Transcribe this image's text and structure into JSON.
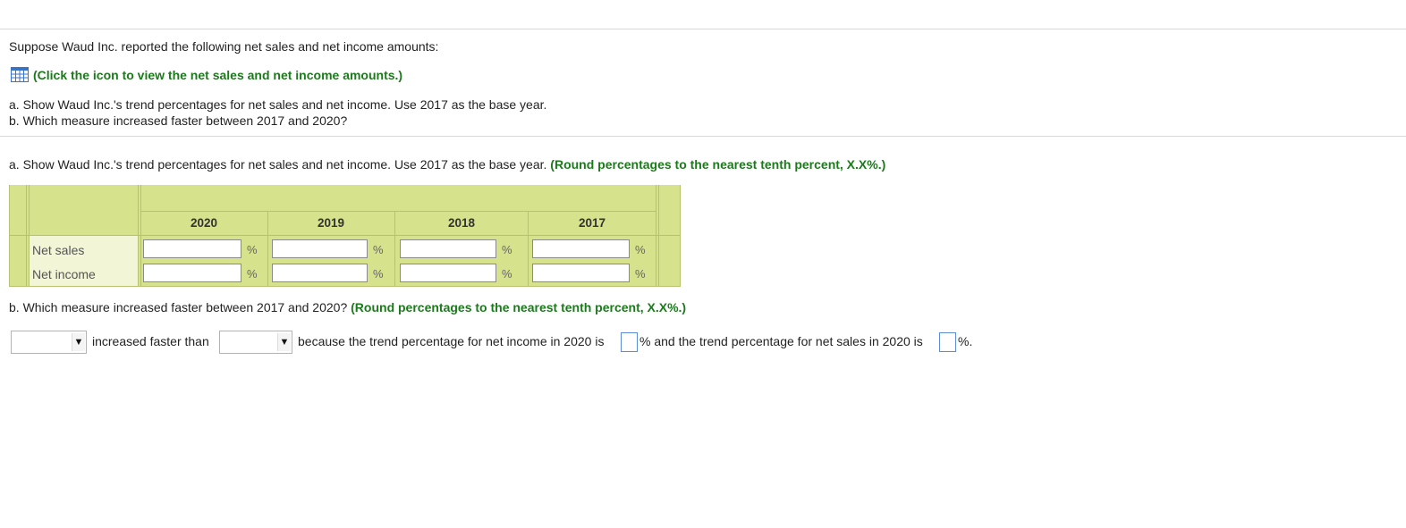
{
  "intro": {
    "statement": "Suppose Waud Inc. reported the following net sales and net income amounts:",
    "icon_link_text": "(Click the icon to view the net sales and net income amounts.)",
    "icon": "calculator-table-icon",
    "question_a": "a. Show Waud Inc.'s trend percentages for net sales and net income. Use 2017 as the base year.",
    "question_b": "b. Which measure increased faster between 2017 and 2020?"
  },
  "part_a": {
    "prompt": "a. Show Waud Inc.'s trend percentages for net sales and net income. Use 2017 as the base year.",
    "hint": "(Round percentages to the nearest tenth percent, X.X%.)",
    "columns": [
      "2020",
      "2019",
      "2018",
      "2017"
    ],
    "rows": [
      {
        "label": "Net sales",
        "values": [
          "",
          "",
          "",
          ""
        ]
      },
      {
        "label": "Net income",
        "values": [
          "",
          "",
          "",
          ""
        ]
      }
    ],
    "percent_symbol": "%"
  },
  "part_b": {
    "prompt": "b. Which measure increased faster between 2017 and 2020?",
    "hint": "(Round percentages to the nearest tenth percent, X.X%.)",
    "select_1_value": "",
    "text_1": "increased faster than",
    "select_2_value": "",
    "text_2": "because the trend percentage for net income in 2020 is",
    "text_3": "% and the trend percentage for net sales in 2020 is",
    "text_4": "%.",
    "net_income_2020_value": "",
    "net_sales_2020_value": ""
  },
  "colors": {
    "accent_green": "#1c7a1c",
    "table_bg": "#d7e28d",
    "input_border_blue": "#5a8ed0"
  }
}
